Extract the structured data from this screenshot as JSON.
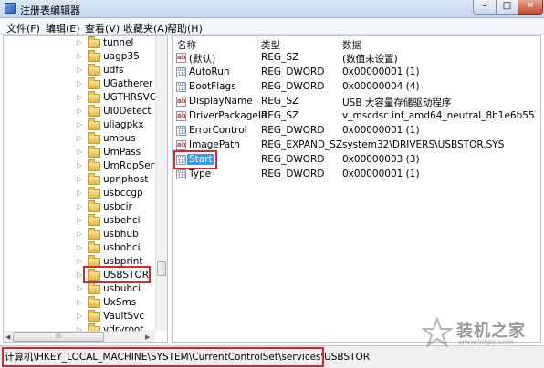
{
  "window": {
    "title": "注册表编辑器",
    "buttons": {
      "minimize": "–",
      "maximize": "□",
      "close": "✕"
    }
  },
  "menu": [
    "文件(F)",
    "编辑(E)",
    "查看(V)",
    "收藏夹(A)",
    "帮助(H)"
  ],
  "tree": {
    "items": [
      {
        "label": "tunnel",
        "expandable": true
      },
      {
        "label": "uagp35",
        "expandable": true
      },
      {
        "label": "udfs",
        "expandable": true
      },
      {
        "label": "UGatherer",
        "expandable": true
      },
      {
        "label": "UGTHRSVC",
        "expandable": true
      },
      {
        "label": "UI0Detect",
        "expandable": true
      },
      {
        "label": "uliagpkx",
        "expandable": true
      },
      {
        "label": "umbus",
        "expandable": true
      },
      {
        "label": "UmPass",
        "expandable": true
      },
      {
        "label": "UmRdpService",
        "expandable": true
      },
      {
        "label": "upnphost",
        "expandable": true
      },
      {
        "label": "usbccgp",
        "expandable": true
      },
      {
        "label": "usbcir",
        "expandable": true
      },
      {
        "label": "usbehci",
        "expandable": true
      },
      {
        "label": "usbhub",
        "expandable": true
      },
      {
        "label": "usbohci",
        "expandable": true
      },
      {
        "label": "usbprint",
        "expandable": true
      },
      {
        "label": "USBSTOR",
        "expandable": true,
        "selected": true
      },
      {
        "label": "usbuhci",
        "expandable": true
      },
      {
        "label": "UxSms",
        "expandable": true
      },
      {
        "label": "VaultSvc",
        "expandable": true
      },
      {
        "label": "vdrvroot",
        "expandable": true
      }
    ],
    "hscroll_glyph": "III"
  },
  "list": {
    "columns": {
      "name": "名称",
      "type": "类型",
      "data": "数据"
    },
    "rows": [
      {
        "icon": "string-value-icon",
        "name": "(默认)",
        "type": "REG_SZ",
        "data": "(数值未设置)"
      },
      {
        "icon": "binary-value-icon",
        "name": "AutoRun",
        "type": "REG_DWORD",
        "data": "0x00000001 (1)"
      },
      {
        "icon": "binary-value-icon",
        "name": "BootFlags",
        "type": "REG_DWORD",
        "data": "0x00000004 (4)"
      },
      {
        "icon": "string-value-icon",
        "name": "DisplayName",
        "type": "REG_SZ",
        "data": "USB 大容量存储驱动程序"
      },
      {
        "icon": "string-value-icon",
        "name": "DriverPackageId",
        "type": "REG_SZ",
        "data": "v_mscdsc.inf_amd64_neutral_8b1e6b55729c32..."
      },
      {
        "icon": "binary-value-icon",
        "name": "ErrorControl",
        "type": "REG_DWORD",
        "data": "0x00000001 (1)"
      },
      {
        "icon": "string-value-icon",
        "name": "ImagePath",
        "type": "REG_EXPAND_SZ",
        "data": "system32\\DRIVERS\\USBSTOR.SYS"
      },
      {
        "icon": "binary-value-icon",
        "name": "Start",
        "type": "REG_DWORD",
        "data": "0x00000003 (3)",
        "selected": true
      },
      {
        "icon": "binary-value-icon",
        "name": "Type",
        "type": "REG_DWORD",
        "data": "0x00000001 (1)"
      }
    ]
  },
  "status": {
    "path": "计算机\\HKEY_LOCAL_MACHINE\\SYSTEM\\CurrentControlSet\\services\\USBSTOR"
  },
  "watermark": {
    "text": "装机之家",
    "url": "www.lotpc.com"
  },
  "colors": {
    "highlight_box": "#e0242b",
    "selection": "#3399ff"
  }
}
